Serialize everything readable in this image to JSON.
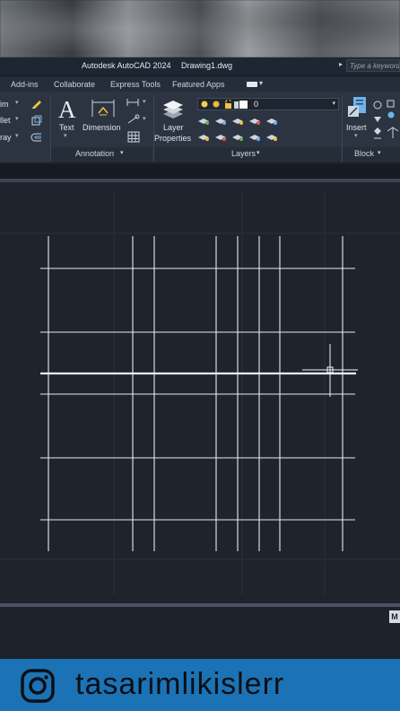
{
  "window": {
    "app_title": "Autodesk AutoCAD 2024",
    "doc_title": "Drawing1.dwg",
    "search_placeholder": "Type a keyword"
  },
  "tabs": [
    "Add-ins",
    "Collaborate",
    "Express Tools",
    "Featured Apps"
  ],
  "ribbon": {
    "modify_partial": [
      "im",
      "llet",
      "ray"
    ],
    "annotation": {
      "text_label": "Text",
      "dimension_label": "Dimension",
      "panel_label": "Annotation"
    },
    "layers": {
      "layer_properties_label_1": "Layer",
      "layer_properties_label_2": "Properties",
      "current_layer": "0",
      "panel_label": "Layers"
    },
    "block": {
      "insert_label": "Insert",
      "panel_label": "Block"
    }
  },
  "command_line": {
    "model_tab_partial": "M"
  },
  "banner": {
    "handle": "tasarimlikislerr"
  },
  "colors": {
    "ribbon_bg": "#2c3441",
    "canvas_bg": "#1e232c",
    "banner_bg": "#1b73b6",
    "drawing_lines": "#e8ecef"
  }
}
